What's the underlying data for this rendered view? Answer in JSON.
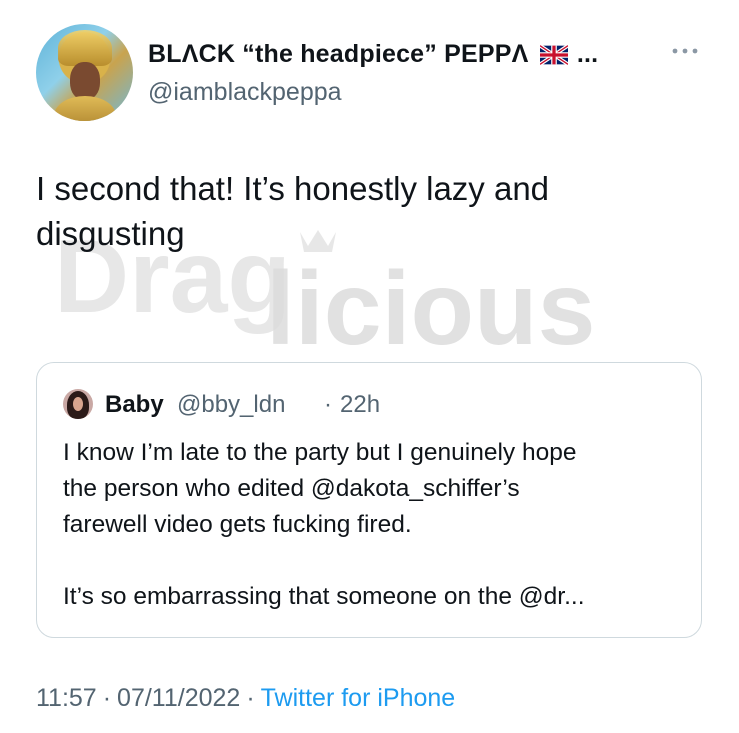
{
  "author": {
    "display_name": "BLΛCK “the headpiece” PEPPΛ",
    "name_truncation": "...",
    "handle": "@iamblackpeppa"
  },
  "tweet": {
    "text_line1": "I second that! It’s honestly lazy and",
    "text_line2": "disgusting"
  },
  "watermark": {
    "text_part1": "Drag",
    "text_part2": "licious"
  },
  "quoted_tweet": {
    "name": "Baby",
    "handle": "@bby_ldn",
    "separator": "·",
    "time": "22h",
    "line1": "I know I’m late to the party but I genuinely hope",
    "line2": "the person who edited @dakota_schiffer’s",
    "line3": "farewell video gets fucking fired.",
    "line4": "It’s so embarrassing that someone on the @dr..."
  },
  "footer": {
    "time": "11:57",
    "separator": "·",
    "date": "07/11/2022",
    "source": "Twitter for iPhone"
  },
  "icons": {
    "flag": "uk-flag-icon",
    "more": "more-icon"
  },
  "colors": {
    "text_primary": "#0f1419",
    "text_secondary": "#536471",
    "link": "#1d9bf0",
    "border": "#cfd9de"
  }
}
